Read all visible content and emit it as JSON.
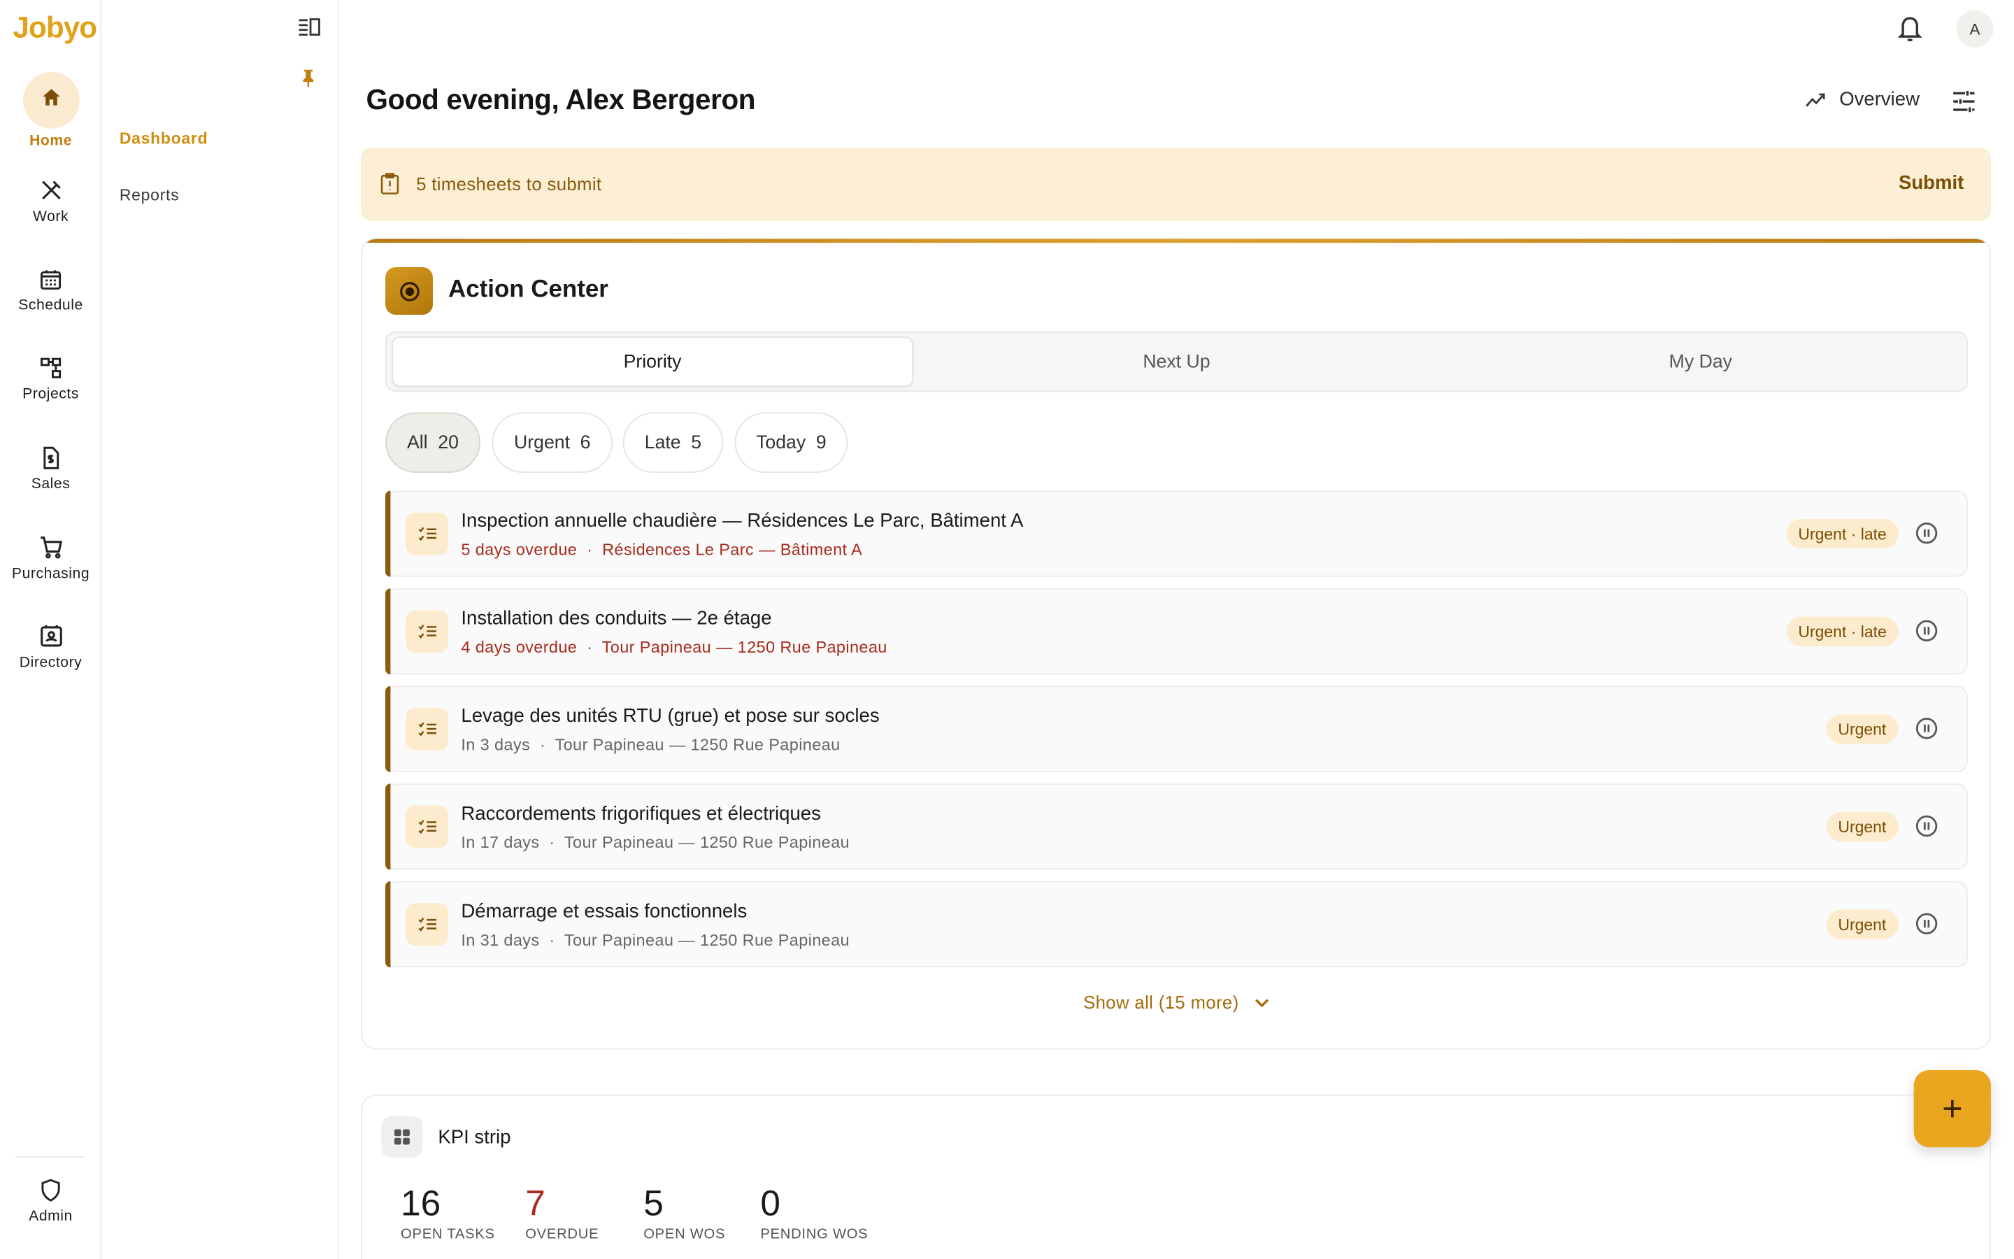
{
  "app": {
    "logo": "Jobyo"
  },
  "rail": {
    "items": [
      {
        "label": "Home",
        "icon": "home-icon"
      },
      {
        "label": "Work",
        "icon": "tools-icon"
      },
      {
        "label": "Schedule",
        "icon": "calendar-icon"
      },
      {
        "label": "Projects",
        "icon": "projects-icon"
      },
      {
        "label": "Sales",
        "icon": "invoice-icon"
      },
      {
        "label": "Purchasing",
        "icon": "cart-icon"
      },
      {
        "label": "Directory",
        "icon": "contacts-icon"
      }
    ],
    "admin": {
      "label": "Admin",
      "icon": "shield-icon"
    }
  },
  "subnav": {
    "items": [
      {
        "label": "Dashboard"
      },
      {
        "label": "Reports"
      }
    ]
  },
  "topbar": {
    "avatar": "A"
  },
  "main": {
    "greeting": "Good evening, Alex Bergeron",
    "overview_label": "Overview",
    "banner": {
      "text": "5 timesheets to submit",
      "action": "Submit"
    }
  },
  "action_center": {
    "title": "Action Center",
    "tabs": [
      {
        "label": "Priority"
      },
      {
        "label": "Next Up"
      },
      {
        "label": "My Day"
      }
    ],
    "filters": [
      {
        "label": "All",
        "count": "20"
      },
      {
        "label": "Urgent",
        "count": "6"
      },
      {
        "label": "Late",
        "count": "5"
      },
      {
        "label": "Today",
        "count": "9"
      }
    ],
    "rows": [
      {
        "title": "Inspection annuelle chaudière — Résidences Le Parc, Bâtiment A",
        "when": "5 days overdue",
        "sep": "·",
        "location": "Résidences Le Parc — Bâtiment A",
        "badge": "Urgent · late"
      },
      {
        "title": "Installation des conduits — 2e étage",
        "when": "4 days overdue",
        "sep": "·",
        "location": "Tour Papineau — 1250 Rue Papineau",
        "badge": "Urgent · late"
      },
      {
        "title": "Levage des unités RTU (grue) et pose sur socles",
        "when": "In 3 days",
        "sep": "·",
        "location": "Tour Papineau — 1250 Rue Papineau",
        "badge": "Urgent"
      },
      {
        "title": "Raccordements frigorifiques et électriques",
        "when": "In 17 days",
        "sep": "·",
        "location": "Tour Papineau — 1250 Rue Papineau",
        "badge": "Urgent"
      },
      {
        "title": "Démarrage et essais fonctionnels",
        "when": "In 31 days",
        "sep": "·",
        "location": "Tour Papineau — 1250 Rue Papineau",
        "badge": "Urgent"
      }
    ],
    "show_all": "Show all (15 more)"
  },
  "kpi": {
    "title": "KPI strip",
    "items": [
      {
        "value": "16",
        "label": "OPEN TASKS"
      },
      {
        "value": "7",
        "label": "OVERDUE"
      },
      {
        "value": "5",
        "label": "OPEN WOS"
      },
      {
        "value": "0",
        "label": "PENDING WOS"
      }
    ]
  },
  "colors": {
    "accent": "#e0a21b",
    "accent_dark": "#8d5a0a",
    "banner_bg": "#fcefd6",
    "overdue": "#a82b1e"
  }
}
